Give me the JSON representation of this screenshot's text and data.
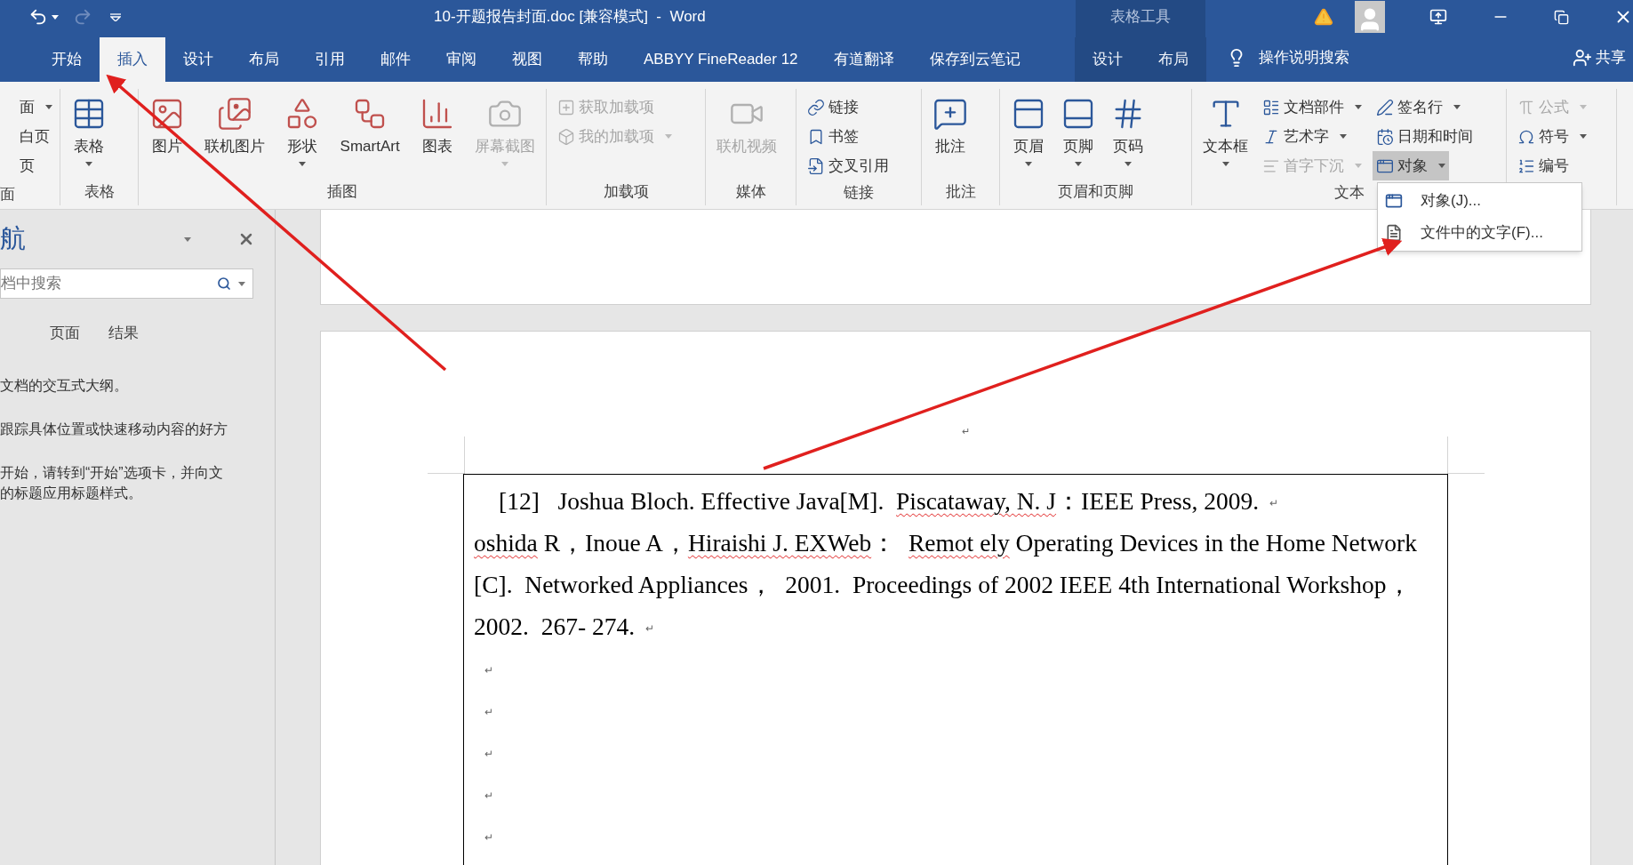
{
  "title_bar": {
    "quick_access": [
      {
        "kind": "undo",
        "disabled": false
      },
      {
        "kind": "redo",
        "disabled": true
      },
      {
        "kind": "customize",
        "disabled": false
      }
    ],
    "title": "10-开题报告封面.doc [兼容模式]  -  Word",
    "context_header": "表格工具"
  },
  "tabs": [
    {
      "label": "开始",
      "selected": false,
      "contextual": false
    },
    {
      "label": "插入",
      "selected": true,
      "contextual": false
    },
    {
      "label": "设计",
      "selected": false,
      "contextual": false
    },
    {
      "label": "布局",
      "selected": false,
      "contextual": false
    },
    {
      "label": "引用",
      "selected": false,
      "contextual": false
    },
    {
      "label": "邮件",
      "selected": false,
      "contextual": false
    },
    {
      "label": "审阅",
      "selected": false,
      "contextual": false
    },
    {
      "label": "视图",
      "selected": false,
      "contextual": false
    },
    {
      "label": "帮助",
      "selected": false,
      "contextual": false
    },
    {
      "label": "ABBYY FineReader 12",
      "selected": false,
      "contextual": false
    },
    {
      "label": "有道翻译",
      "selected": false,
      "contextual": false
    },
    {
      "label": "保存到云笔记",
      "selected": false,
      "contextual": false
    },
    {
      "label": "设计",
      "selected": false,
      "contextual": true
    },
    {
      "label": "布局",
      "selected": false,
      "contextual": true
    }
  ],
  "tell_me": "操作说明搜索",
  "share": "共享",
  "ribbon": {
    "groups": [
      {
        "label": "面",
        "items": [
          {
            "kind": "small",
            "label": "面",
            "dropdown": true,
            "disabled": false,
            "pressed": false
          },
          {
            "kind": "small",
            "label": "白页",
            "dropdown": false,
            "disabled": false,
            "pressed": false
          },
          {
            "kind": "small",
            "label": "页",
            "dropdown": false,
            "disabled": false,
            "pressed": false
          }
        ]
      },
      {
        "label": "表格",
        "items": [
          {
            "kind": "large",
            "label": "表格",
            "dropdown": true,
            "disabled": false,
            "pressed": false
          }
        ]
      },
      {
        "label": "插图",
        "items": [
          {
            "kind": "large",
            "label": "图片",
            "dropdown": false,
            "disabled": false,
            "pressed": false
          },
          {
            "kind": "large",
            "label": "联机图片",
            "dropdown": false,
            "disabled": false,
            "pressed": false
          },
          {
            "kind": "large",
            "label": "形状",
            "dropdown": true,
            "disabled": false,
            "pressed": false
          },
          {
            "kind": "large",
            "label": "SmartArt",
            "dropdown": false,
            "disabled": false,
            "pressed": false
          },
          {
            "kind": "large",
            "label": "图表",
            "dropdown": false,
            "disabled": false,
            "pressed": false
          },
          {
            "kind": "large",
            "label": "屏幕截图",
            "dropdown": true,
            "disabled": true,
            "pressed": false
          }
        ]
      },
      {
        "label": "加载项",
        "items": [
          {
            "kind": "small",
            "label": "获取加载项",
            "dropdown": false,
            "disabled": true,
            "pressed": false
          },
          {
            "kind": "small",
            "label": "我的加载项",
            "dropdown": true,
            "disabled": true,
            "pressed": false
          }
        ]
      },
      {
        "label": "媒体",
        "items": [
          {
            "kind": "large",
            "label": "联机视频",
            "dropdown": false,
            "disabled": true,
            "pressed": false
          }
        ]
      },
      {
        "label": "链接",
        "items": [
          {
            "kind": "small",
            "label": "链接",
            "dropdown": false,
            "disabled": false,
            "pressed": false
          },
          {
            "kind": "small",
            "label": "书签",
            "dropdown": false,
            "disabled": false,
            "pressed": false
          },
          {
            "kind": "small",
            "label": "交叉引用",
            "dropdown": false,
            "disabled": false,
            "pressed": false
          }
        ]
      },
      {
        "label": "批注",
        "items": [
          {
            "kind": "large",
            "label": "批注",
            "dropdown": false,
            "disabled": false,
            "pressed": false
          }
        ]
      },
      {
        "label": "页眉和页脚",
        "items": [
          {
            "kind": "large",
            "label": "页眉",
            "dropdown": true,
            "disabled": false,
            "pressed": false
          },
          {
            "kind": "large",
            "label": "页脚",
            "dropdown": true,
            "disabled": false,
            "pressed": false
          },
          {
            "kind": "large",
            "label": "页码",
            "dropdown": true,
            "disabled": false,
            "pressed": false
          }
        ]
      },
      {
        "label": "文本",
        "items": [
          {
            "kind": "large",
            "label": "文本框",
            "dropdown": true,
            "disabled": false,
            "pressed": false
          },
          {
            "kind": "small",
            "label": "文档部件",
            "dropdown": true,
            "disabled": false,
            "pressed": false
          },
          {
            "kind": "small",
            "label": "艺术字",
            "dropdown": true,
            "disabled": false,
            "pressed": false
          },
          {
            "kind": "small",
            "label": "首字下沉",
            "dropdown": true,
            "disabled": true,
            "pressed": false
          },
          {
            "kind": "small",
            "label": "签名行",
            "dropdown": true,
            "disabled": false,
            "pressed": false
          },
          {
            "kind": "small",
            "label": "日期和时间",
            "dropdown": false,
            "disabled": false,
            "pressed": false
          },
          {
            "kind": "small",
            "label": "对象",
            "dropdown": true,
            "disabled": false,
            "pressed": true
          }
        ]
      },
      {
        "items": [
          {
            "kind": "small",
            "label": "公式",
            "dropdown": true,
            "disabled": true,
            "pressed": false
          },
          {
            "kind": "small",
            "label": "符号",
            "dropdown": true,
            "disabled": false,
            "pressed": false
          },
          {
            "kind": "small",
            "label": "编号",
            "dropdown": false,
            "disabled": false,
            "pressed": false
          }
        ]
      }
    ]
  },
  "object_menu": {
    "items": [
      {
        "label": "对象(J)..."
      },
      {
        "label": "文件中的文字(F)..."
      }
    ]
  },
  "nav_pane": {
    "title": "航",
    "search": {
      "placeholder": "档中搜索"
    },
    "tabs": [
      {
        "label": "页面",
        "selected": false
      },
      {
        "label": "结果",
        "selected": false
      }
    ],
    "hints": [
      {
        "lines": [
          "文档的交互式大纲。"
        ]
      },
      {
        "lines": [
          "跟踪具体位置或快速移动内容的好方"
        ]
      },
      {
        "lines": [
          "开始，请转到“开始”选项卡，并向文",
          "的标题应用标题样式。"
        ]
      }
    ]
  },
  "document": {
    "top_mark": "↵",
    "paragraphs": [
      {
        "lines": [
          [
            {
              "text": "[12]   Joshua Bloch. Effective Java[M].  ",
              "misspelled": false
            },
            {
              "text": "Piscataway, N. J",
              "misspelled": true
            },
            {
              "text": "：IEEE Press, 2009.",
              "misspelled": false
            }
          ]
        ],
        "mark": "↵"
      },
      {
        "lines": [
          [
            {
              "text": "oshida",
              "misspelled": true
            },
            {
              "text": " R，Inoue A，",
              "misspelled": false
            },
            {
              "text": "Hiraishi J. EXWeb",
              "misspelled": true
            },
            {
              "text": "：  ",
              "misspelled": false
            },
            {
              "text": "Remot ely",
              "misspelled": true
            },
            {
              "text": " Operating Devices in the Home Network",
              "misspelled": false
            }
          ],
          [
            {
              "text": "[C].  Networked Appliances，  2001.  Proceedings of 2002 IEEE 4th International Workshop，",
              "misspelled": false
            }
          ],
          [
            {
              "text": "2002.  267- 274.",
              "misspelled": false
            }
          ]
        ],
        "mark": "↵"
      },
      {
        "mark": "↵"
      },
      {
        "mark": "↵"
      },
      {
        "mark": "↵"
      },
      {
        "mark": "↵"
      },
      {
        "mark": "↵"
      }
    ]
  }
}
